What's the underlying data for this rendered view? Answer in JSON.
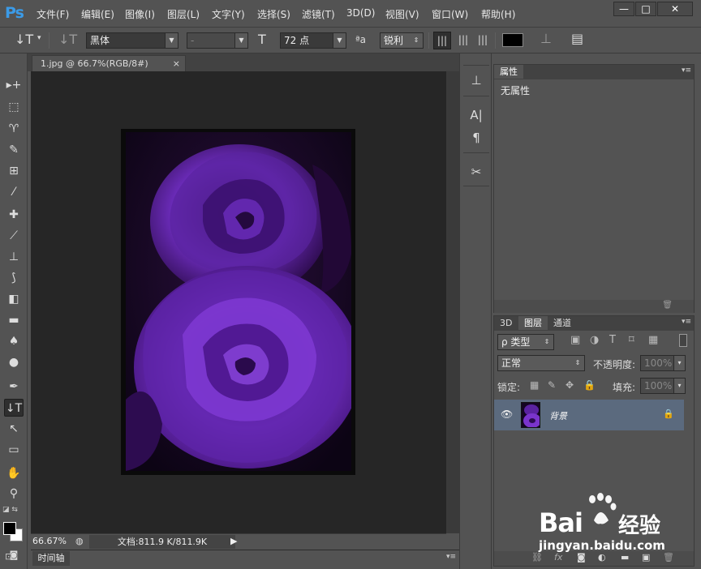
{
  "app": {
    "logo": "Ps"
  },
  "menu": [
    "文件(F)",
    "编辑(E)",
    "图像(I)",
    "图层(L)",
    "文字(Y)",
    "选择(S)",
    "滤镜(T)",
    "3D(D)",
    "视图(V)",
    "窗口(W)",
    "帮助(H)"
  ],
  "window_controls": {
    "minimize": "—",
    "maximize": "□",
    "close": "✕"
  },
  "options": {
    "tool_icon": "↓T",
    "font_family": "黑体",
    "font_style": "-",
    "size_icon": "T",
    "font_size": "72 点",
    "aa_icon": "ªa",
    "antialias": "锐利",
    "color_hex": "#000000"
  },
  "document": {
    "tab_title": "1.jpg @ 66.7%(RGB/8#)",
    "tab_close": "×"
  },
  "status": {
    "zoom": "66.67%",
    "info": "文档:811.9 K/811.9K"
  },
  "timeline": {
    "label": "时间轴"
  },
  "properties": {
    "tab": "属性",
    "content": "无属性"
  },
  "layers": {
    "tabs": [
      "3D",
      "图层",
      "通道"
    ],
    "filter_label": "ρ 类型",
    "blend_mode": "正常",
    "opacity_label": "不透明度:",
    "opacity_value": "100%",
    "lock_label": "锁定:",
    "fill_label": "填充:",
    "fill_value": "100%",
    "layer_name": "背景"
  },
  "watermark": {
    "brand": "Bai",
    "brand_cn": "经验",
    "url": "jingyan.baidu.com"
  }
}
